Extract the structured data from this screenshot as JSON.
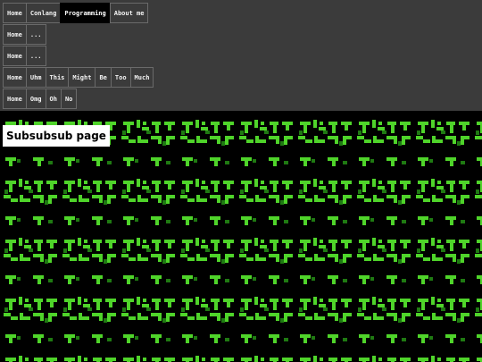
{
  "nav": {
    "rows": [
      [
        "Home",
        "Conlang",
        "Programming",
        "About me"
      ],
      [
        "Home",
        "..."
      ],
      [
        "Home",
        "..."
      ],
      [
        "Home",
        "Uhm",
        "This",
        "Might",
        "Be",
        "Too",
        "Much"
      ],
      [
        "Home",
        "Omg",
        "Oh",
        "No"
      ]
    ],
    "active": "Programming"
  },
  "page_title": "Subsubsub page",
  "colors": {
    "nav_background": "#3b3b3b",
    "page_background": "#000000",
    "pattern_green": "#4fd42a",
    "pattern_dark_green": "#1f7a12"
  }
}
